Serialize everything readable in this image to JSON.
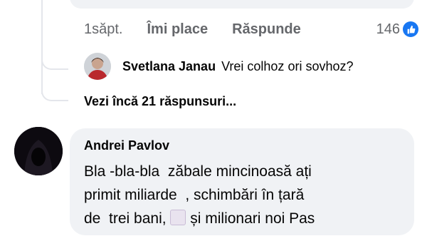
{
  "top_comment": {
    "time": "1săpt.",
    "like_label": "Îmi place",
    "reply_label": "Răspunde",
    "reaction_count": "146",
    "reaction_icon": "like-icon",
    "colors": {
      "meta_text": "#65676b",
      "like_badge": "#1877f2",
      "bubble": "#f0f2f5"
    }
  },
  "reply": {
    "author": "Svetlana Janau",
    "text": "Vrei colhoz ori sovhoz?"
  },
  "more_replies": "Vezi încă 21 răspunsuri...",
  "comment": {
    "author": "Andrei Pavlov",
    "line1": "Bla -bla-bla  zăbale mincinoasă ați",
    "line2": "primit miliarde  , schimbări în țară",
    "line3a": "de  trei bani, ",
    "line3b": " și milionari noi Pas",
    "emoji": "book-emoji"
  }
}
